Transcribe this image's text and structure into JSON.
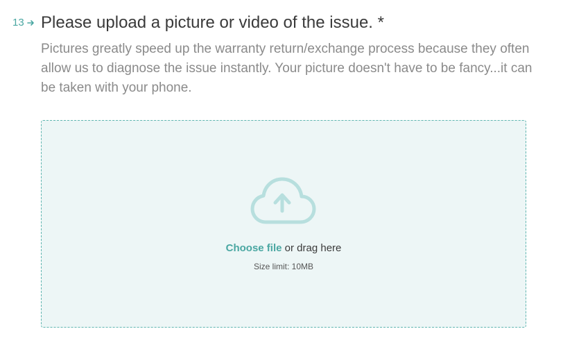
{
  "question": {
    "number": "13",
    "title": "Please upload a picture or video of the issue. *",
    "description": "Pictures greatly speed up the warranty return/exchange process because they often allow us to diagnose the issue instantly. Your picture doesn't have to be fancy...it can be taken with your phone."
  },
  "upload": {
    "choose_label": "Choose file",
    "drag_text": " or drag here",
    "size_limit": "Size limit: 10MB",
    "icon": "cloud-upload-icon"
  },
  "colors": {
    "accent": "#4aa7a2",
    "dropzone_bg": "#edf6f6",
    "dropzone_border": "#5fb5b0",
    "icon": "#b7dfde"
  }
}
